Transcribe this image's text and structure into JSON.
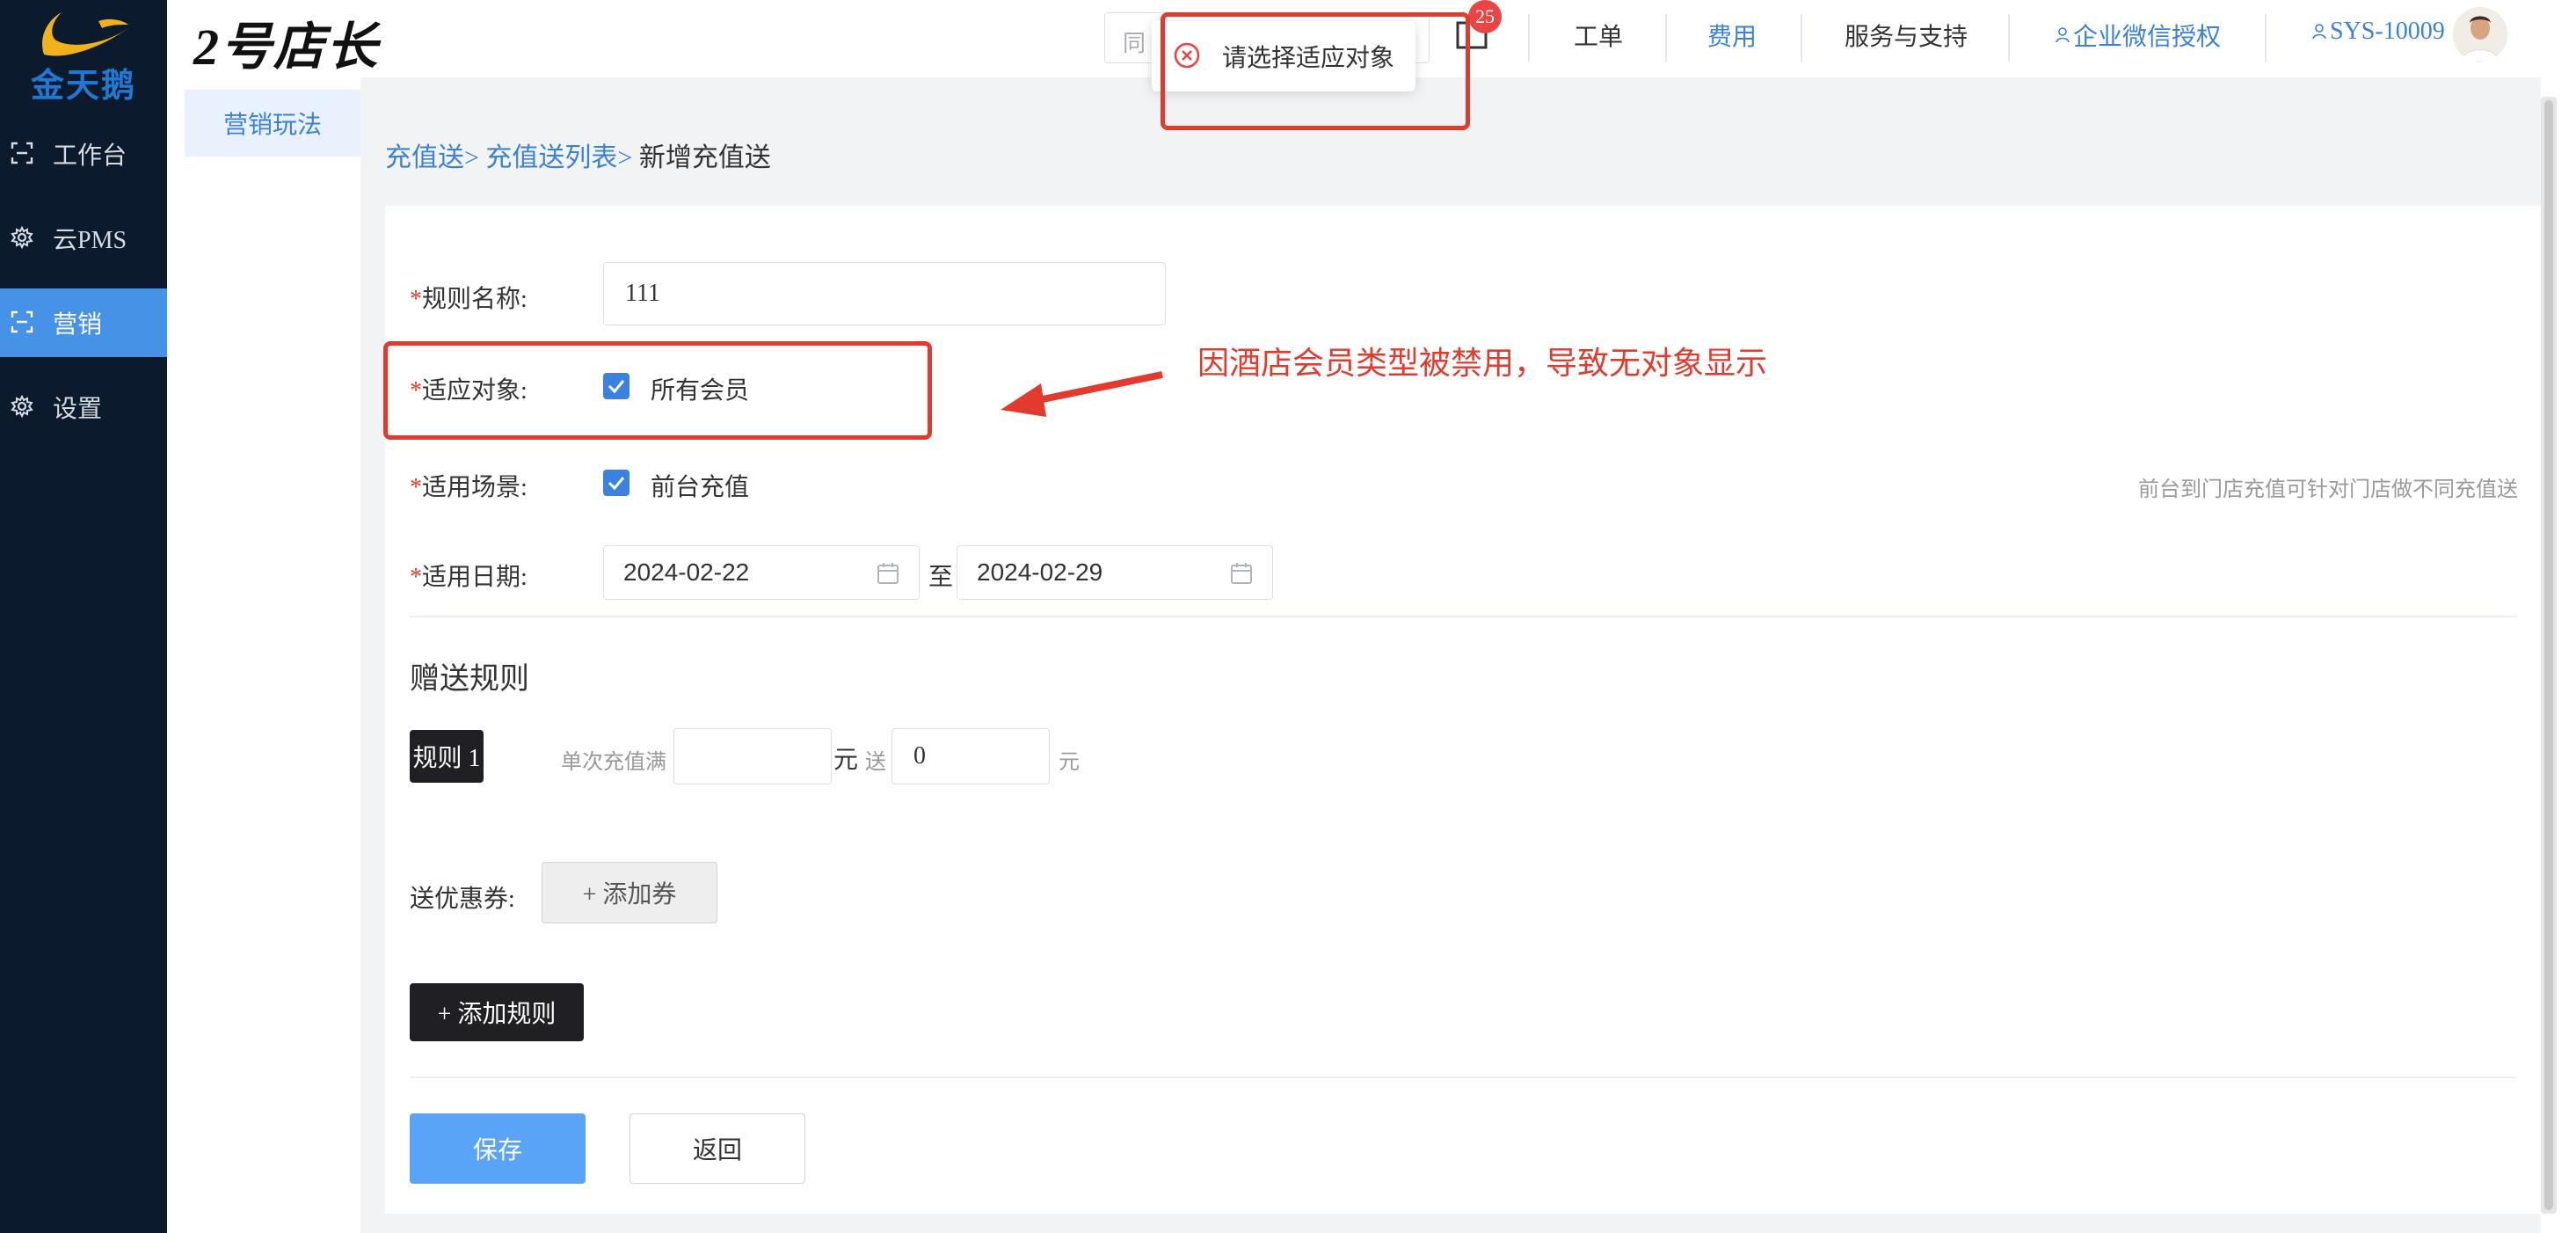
{
  "app": {
    "logo_text": "金天鹅",
    "brand": "2号店长"
  },
  "sidebar": {
    "items": [
      {
        "label": "工作台",
        "icon": "workbench-icon"
      },
      {
        "label": "云PMS",
        "icon": "gear-icon"
      },
      {
        "label": "营销",
        "icon": "marketing-icon",
        "active": true
      },
      {
        "label": "设置",
        "icon": "gear-icon"
      }
    ]
  },
  "subnav": {
    "items": [
      {
        "label": "营销玩法",
        "active": true
      }
    ]
  },
  "header": {
    "search_placeholder": "同",
    "badge_count": "25",
    "links": {
      "ticket": "工单",
      "fee": "费用",
      "service": "服务与支持",
      "wechat": "企业微信授权",
      "user": "SYS-10009"
    }
  },
  "toast": {
    "message": "请选择适应对象",
    "icon": "error-circle-icon"
  },
  "breadcrumb": {
    "level1": "充值送>",
    "level2": "充值送列表>",
    "current": "新增充值送"
  },
  "form": {
    "required_mark": "*",
    "rule_name": {
      "label": "规则名称:",
      "value": "111"
    },
    "target": {
      "label": "适应对象:",
      "option": "所有会员",
      "checked": true
    },
    "scene": {
      "label": "适用场景:",
      "option": "前台充值",
      "checked": true,
      "hint": "前台到门店充值可针对门店做不同充值送"
    },
    "date": {
      "label": "适用日期:",
      "start": "2024-02-22",
      "separator": "至",
      "end": "2024-02-29"
    }
  },
  "gift_rules": {
    "title": "赠送规则",
    "rules": [
      {
        "tag": "规则 1",
        "min_label": "单次充值满",
        "min_value": "",
        "unit1": "元",
        "send_label": "送",
        "send_value": "0",
        "unit2": "元"
      }
    ],
    "coupon_label": "送优惠券:",
    "add_coupon": "+ 添加券",
    "add_rule": "+ 添加规则"
  },
  "actions": {
    "save": "保存",
    "back": "返回"
  },
  "annotation": {
    "text": "因酒店会员类型被禁用，导致无对象显示",
    "color": "#e23b2d"
  },
  "colors": {
    "sidebar_bg": "#0c1a2e",
    "accent": "#3b82d6",
    "primary_button": "#5aa4f7",
    "annotation": "#e23b2d"
  }
}
